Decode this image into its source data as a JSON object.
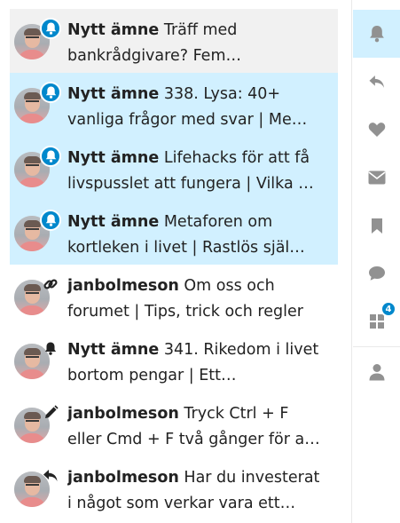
{
  "notifications": [
    {
      "state": "read",
      "icon": "bell-icon",
      "username": "Nytt ämne",
      "line1": "Träff med",
      "line2": "bankrådgivare? Fem…"
    },
    {
      "state": "unread",
      "icon": "bell-icon",
      "username": "Nytt ämne",
      "line1": "338. Lysa: 40+",
      "line2": "vanliga frågor med svar | Me…"
    },
    {
      "state": "unread",
      "icon": "bell-icon",
      "username": "Nytt ämne",
      "line1": "Lifehacks för att få",
      "line2": "livspusslet att fungera | Vilka …"
    },
    {
      "state": "unread",
      "icon": "bell-icon",
      "username": "Nytt ämne",
      "line1": "Metaforen om",
      "line2": "kortleken i livet | Rastlös själ…"
    },
    {
      "state": "plain",
      "icon": "link-icon",
      "username": "janbolmeson",
      "line1": "Om oss och",
      "line2": "forumet | Tips, trick och regler"
    },
    {
      "state": "plain",
      "icon": "bell-icon",
      "username": "Nytt ämne",
      "line1": "341. Rikedom i livet",
      "line2": "bortom pengar | Ett…"
    },
    {
      "state": "plain",
      "icon": "pencil-icon",
      "username": "janbolmeson",
      "line1": "Tryck Ctrl + F",
      "line2": "eller Cmd + F två gånger för a…"
    },
    {
      "state": "plain",
      "icon": "reply-icon",
      "username": "janbolmeson",
      "line1": "Har du investerat",
      "line2": "i något som verkar vara ett…"
    }
  ],
  "sidebar": {
    "chat_unread_count": "4"
  },
  "colors": {
    "accent": "#0088cc",
    "unread_background": "#d1f0ff",
    "read_background": "#f1f1f1",
    "icon_grey": "#919191"
  }
}
